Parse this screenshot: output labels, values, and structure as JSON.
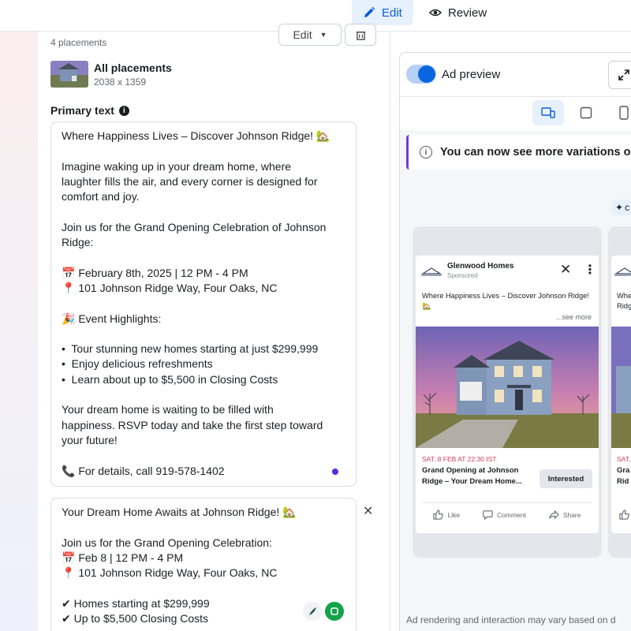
{
  "topbar": {
    "edit_label": "Edit",
    "review_label": "Review"
  },
  "editor": {
    "placements_count": "4 placements",
    "edit_dropdown_label": "Edit",
    "all_placements_label": "All placements",
    "image_dimensions": "2038 x 1359",
    "primary_text_label": "Primary text",
    "primary_text_1_lines": [
      "Where Happiness Lives – Discover Johnson Ridge! 🏡",
      "",
      "Imagine waking up in your dream home, where",
      "laughter fills the air, and every corner is designed for",
      "comfort and joy.",
      "",
      "Join us for the Grand Opening Celebration of Johnson",
      "Ridge:",
      "",
      "📅 February 8th, 2025 | 12 PM - 4 PM",
      "📍 101 Johnson Ridge Way, Four Oaks, NC",
      "",
      "🎉 Event Highlights:",
      "",
      "•  Tour stunning new homes starting at just $299,999",
      "•  Enjoy delicious refreshments",
      "•  Learn about up to $5,500 in Closing Costs",
      "",
      "Your dream home is waiting to be filled with",
      "happiness. RSVP today and take the first step toward",
      "your future!",
      "",
      "📞 For details, call 919-578-1402"
    ],
    "primary_text_2_lines": [
      "Your Dream Home Awaits at Johnson Ridge! 🏡",
      "",
      "Join us for the Grand Opening Celebration:",
      "📅 Feb 8 | 12 PM - 4 PM",
      "📍 101 Johnson Ridge Way, Four Oaks, NC",
      "",
      "✔ Homes starting at $299,999",
      "✔ Up to $5,500 Closing Costs"
    ]
  },
  "preview": {
    "toggle_label": "Ad preview",
    "toggle_on": true,
    "notice_text": "You can now see more variations o",
    "ad_card": {
      "brand_name": "Glenwood Homes",
      "sponsored_label": "Sponsored",
      "text": "Where Happiness Lives – Discover Johnson Ridge! 🏡",
      "see_more": "...see more",
      "event_date": "SAT, 8 FEB AT 22:30 IST",
      "event_title": "Grand Opening at Johnson Ridge – Your Dream Home...",
      "interested_label": "Interested",
      "like_label": "Like",
      "comment_label": "Comment",
      "share_label": "Share"
    },
    "ad_card_2": {
      "text_fragment_1": "Whe",
      "text_fragment_2": "Ridg",
      "date_fragment": "SAT,",
      "title_fragment_1": "Gra",
      "title_fragment_2": "Rid"
    },
    "disclaimer": "Ad rendering and interaction may vary based on d"
  },
  "colors": {
    "accent_blue": "#0a5ed7",
    "notice_border": "#6b3fd4",
    "event_date": "#d03b5a"
  }
}
